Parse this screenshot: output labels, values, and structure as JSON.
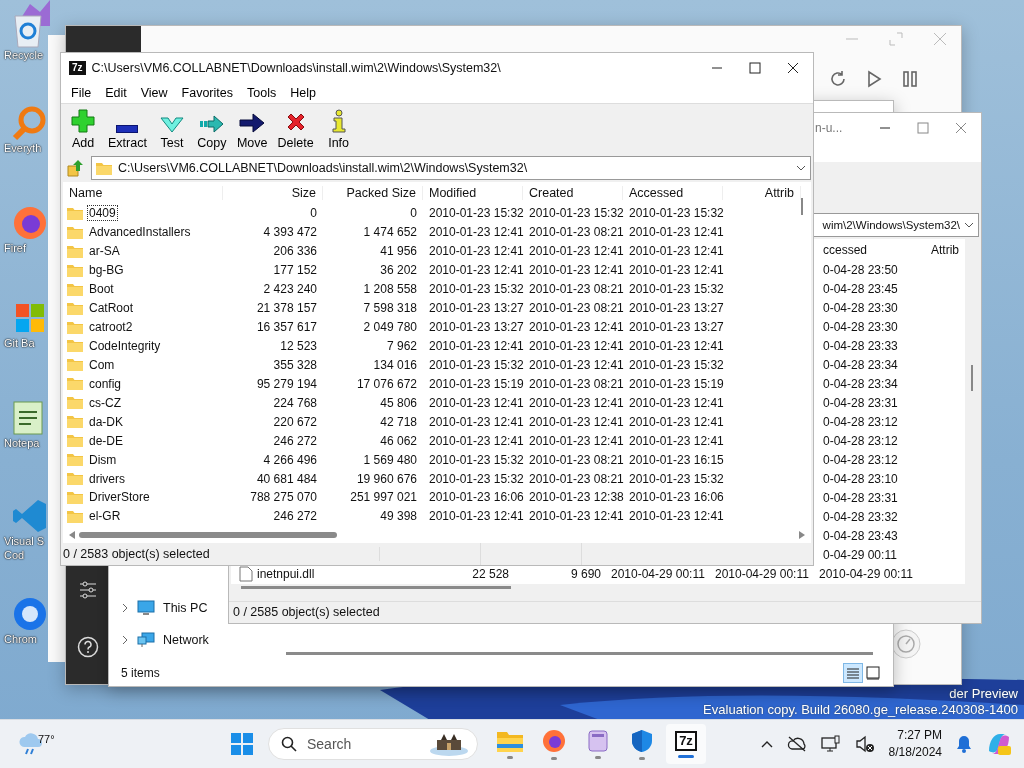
{
  "desktop": {
    "icons": [
      {
        "kind": "vs"
      },
      {
        "kind": "recycle",
        "lines": [
          "Recycle"
        ]
      },
      {
        "kind": "everything",
        "lines": [
          "Everyth"
        ]
      },
      {
        "kind": "firefox",
        "lines": [
          "Firef"
        ]
      },
      {
        "kind": "git",
        "lines": [
          "Git Ba"
        ]
      },
      {
        "kind": "notepad",
        "lines": [
          "Notepa"
        ]
      },
      {
        "kind": "vscode",
        "lines": [
          "Visual S",
          "Cod"
        ]
      },
      {
        "kind": "chrome",
        "lines": [
          "Chrom"
        ]
      }
    ],
    "watermark": [
      "der Preview",
      "Evaluation copy. Build 26080.ge_release.240308-1400"
    ]
  },
  "explorer_window": {
    "nav_items": [
      {
        "label": "This PC",
        "kind": "pc",
        "expanded": false
      },
      {
        "label": "Network",
        "kind": "network",
        "expanded": false
      }
    ],
    "status": "5 items",
    "views": [
      {
        "kind": "details",
        "selected": true
      },
      {
        "kind": "tiles",
        "selected": false
      }
    ]
  },
  "second_archive_window": {
    "title": "n-u...",
    "path": "wim\\2\\Windows\\System32\\",
    "columns": [
      "ccessed",
      "Attrib"
    ],
    "accessed": [
      "0-04-28 23:50",
      "0-04-28 23:45",
      "0-04-28 23:30",
      "0-04-28 23:30",
      "0-04-28 23:33",
      "0-04-28 23:34",
      "0-04-28 23:34",
      "0-04-28 23:31",
      "0-04-28 23:12",
      "0-04-28 23:12",
      "0-04-28 23:12",
      "0-04-28 23:10",
      "0-04-28 23:31",
      "0-04-28 23:32",
      "0-04-28 23:43",
      "0-04-29 00:11"
    ],
    "last_row": {
      "name": "inetnpui.dll",
      "size": "22 528",
      "packed_size": "9 690",
      "modified": "2010-04-29 00:11",
      "created": "2010-04-29 00:11",
      "accessed": "2010-04-29 00:11"
    },
    "status": "0 / 2585 object(s) selected"
  },
  "archive_window": {
    "app_badge": "7z",
    "title": "C:\\Users\\VM6.COLLABNET\\Downloads\\install.wim\\2\\Windows\\System32\\",
    "menu": [
      "File",
      "Edit",
      "View",
      "Favorites",
      "Tools",
      "Help"
    ],
    "toolbar": [
      {
        "label": "Add",
        "kind": "add"
      },
      {
        "label": "Extract",
        "kind": "extract"
      },
      {
        "label": "Test",
        "kind": "test"
      },
      {
        "label": "Copy",
        "kind": "copy"
      },
      {
        "label": "Move",
        "kind": "move"
      },
      {
        "label": "Delete",
        "kind": "delete"
      },
      {
        "label": "Info",
        "kind": "info"
      }
    ],
    "path": "C:\\Users\\VM6.COLLABNET\\Downloads\\install.wim\\2\\Windows\\System32\\",
    "columns": [
      "Name",
      "Size",
      "Packed Size",
      "Modified",
      "Created",
      "Accessed",
      "Attrib"
    ],
    "rows": [
      {
        "name": "0409",
        "size": "0",
        "packed": "0",
        "modified": "2010-01-23 15:32",
        "created": "2010-01-23 15:32",
        "accessed": "2010-01-23 15:32",
        "focused": true
      },
      {
        "name": "AdvancedInstallers",
        "size": "4 393 472",
        "packed": "1 474 652",
        "modified": "2010-01-23 12:41",
        "created": "2010-01-23 08:21",
        "accessed": "2010-01-23 12:41",
        "focused": false
      },
      {
        "name": "ar-SA",
        "size": "206 336",
        "packed": "41 956",
        "modified": "2010-01-23 12:41",
        "created": "2010-01-23 12:41",
        "accessed": "2010-01-23 12:41",
        "focused": false
      },
      {
        "name": "bg-BG",
        "size": "177 152",
        "packed": "36 202",
        "modified": "2010-01-23 12:41",
        "created": "2010-01-23 12:41",
        "accessed": "2010-01-23 12:41",
        "focused": false
      },
      {
        "name": "Boot",
        "size": "2 423 240",
        "packed": "1 208 558",
        "modified": "2010-01-23 15:32",
        "created": "2010-01-23 08:21",
        "accessed": "2010-01-23 15:32",
        "focused": false
      },
      {
        "name": "CatRoot",
        "size": "21 378 157",
        "packed": "7 598 318",
        "modified": "2010-01-23 13:27",
        "created": "2010-01-23 08:21",
        "accessed": "2010-01-23 13:27",
        "focused": false
      },
      {
        "name": "catroot2",
        "size": "16 357 617",
        "packed": "2 049 780",
        "modified": "2010-01-23 13:27",
        "created": "2010-01-23 12:41",
        "accessed": "2010-01-23 13:27",
        "focused": false
      },
      {
        "name": "CodeIntegrity",
        "size": "12 523",
        "packed": "7 962",
        "modified": "2010-01-23 12:41",
        "created": "2010-01-23 12:41",
        "accessed": "2010-01-23 12:41",
        "focused": false
      },
      {
        "name": "Com",
        "size": "355 328",
        "packed": "134 016",
        "modified": "2010-01-23 15:32",
        "created": "2010-01-23 12:41",
        "accessed": "2010-01-23 15:32",
        "focused": false
      },
      {
        "name": "config",
        "size": "95 279 194",
        "packed": "17 076 672",
        "modified": "2010-01-23 15:19",
        "created": "2010-01-23 08:21",
        "accessed": "2010-01-23 15:19",
        "focused": false
      },
      {
        "name": "cs-CZ",
        "size": "224 768",
        "packed": "45 806",
        "modified": "2010-01-23 12:41",
        "created": "2010-01-23 12:41",
        "accessed": "2010-01-23 12:41",
        "focused": false
      },
      {
        "name": "da-DK",
        "size": "220 672",
        "packed": "42 718",
        "modified": "2010-01-23 12:41",
        "created": "2010-01-23 12:41",
        "accessed": "2010-01-23 12:41",
        "focused": false
      },
      {
        "name": "de-DE",
        "size": "246 272",
        "packed": "46 062",
        "modified": "2010-01-23 12:41",
        "created": "2010-01-23 12:41",
        "accessed": "2010-01-23 12:41",
        "focused": false
      },
      {
        "name": "Dism",
        "size": "4 266 496",
        "packed": "1 569 480",
        "modified": "2010-01-23 15:32",
        "created": "2010-01-23 08:21",
        "accessed": "2010-01-23 16:15",
        "focused": false
      },
      {
        "name": "drivers",
        "size": "40 681 484",
        "packed": "19 960 676",
        "modified": "2010-01-23 15:32",
        "created": "2010-01-23 08:21",
        "accessed": "2010-01-23 15:32",
        "focused": false
      },
      {
        "name": "DriverStore",
        "size": "788 275 070",
        "packed": "251 997 021",
        "modified": "2010-01-23 16:06",
        "created": "2010-01-23 12:38",
        "accessed": "2010-01-23 16:06",
        "focused": false
      },
      {
        "name": "el-GR",
        "size": "246 272",
        "packed": "49 398",
        "modified": "2010-01-23 12:41",
        "created": "2010-01-23 12:41",
        "accessed": "2010-01-23 12:41",
        "focused": false
      }
    ],
    "status": "0 / 2583 object(s) selected"
  },
  "taskbar": {
    "weather": "77°",
    "search_placeholder": "Search",
    "apps": [
      {
        "kind": "explorer",
        "selected": false
      },
      {
        "kind": "firefox",
        "selected": false
      },
      {
        "kind": "notepad",
        "selected": false
      },
      {
        "kind": "defender",
        "selected": false
      },
      {
        "kind": "sevenzip",
        "label": "7z",
        "selected": true
      }
    ],
    "time": "7:27 PM",
    "date": "8/18/2024"
  }
}
